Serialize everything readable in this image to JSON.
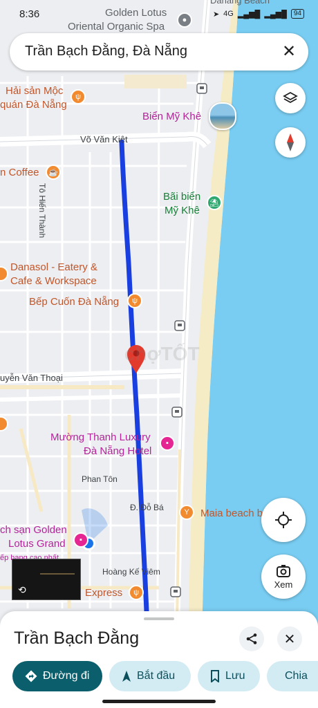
{
  "status_bar": {
    "time": "8:36",
    "network": "4G",
    "battery": "94"
  },
  "search": {
    "query": "Trần Bạch Đằng, Đà Nẵng"
  },
  "map": {
    "top_labels": [
      "Golden Lotus",
      "Oriental Organic Spa",
      "Danang Beach"
    ],
    "roads": {
      "vo_van_kiet": "Võ Văn Kiệt",
      "to_hien_thanh": "Tô Hiến Thành",
      "nguyen_van_thoai": "uyễn Văn Thoại",
      "phan_ton": "Phan Tôn",
      "do_ba": "Đ. Đỗ Bá",
      "hoang_ke_viem": "Hoàng Kế Viêm"
    },
    "places": {
      "hai_san_1": "Hải sản Mộc",
      "hai_san_2": "quán Đà Nẵng",
      "bien_my_khe": "Biển Mỹ Khê",
      "coffee": "n Coffee",
      "bai_bien_1": "Bãi biển",
      "bai_bien_2": "Mỹ Khê",
      "danasol_1": "Danasol - Eatery &",
      "danasol_2": "Cafe & Workspace",
      "bep_cuon": "Bếp Cuốn Đà Nẵng",
      "muong_thanh_1": "Mường Thanh Luxury",
      "muong_thanh_2": "Đà Nẵng Hotel",
      "maia": "Maia beach b",
      "golden_1": "ch sạn Golden",
      "golden_2": "Lotus Grand",
      "golden_3": "ếp hạng cao nhất",
      "express": "Express"
    },
    "watermark": "chợTỐT",
    "colors": {
      "route": "#1a3fe0",
      "water": "#79cdf2",
      "beach": "#f5ecc6",
      "pin": "#e23b2e",
      "location": "#1a73e8"
    }
  },
  "controls": {
    "layers": "layers-icon",
    "compass": "compass-icon",
    "my_location": "my-location-icon",
    "lens_label": "Xem"
  },
  "sheet": {
    "title": "Trần Bạch Đằng",
    "actions": {
      "directions": "Đường đi",
      "start": "Bắt đầu",
      "save": "Lưu",
      "share": "Chia"
    }
  }
}
